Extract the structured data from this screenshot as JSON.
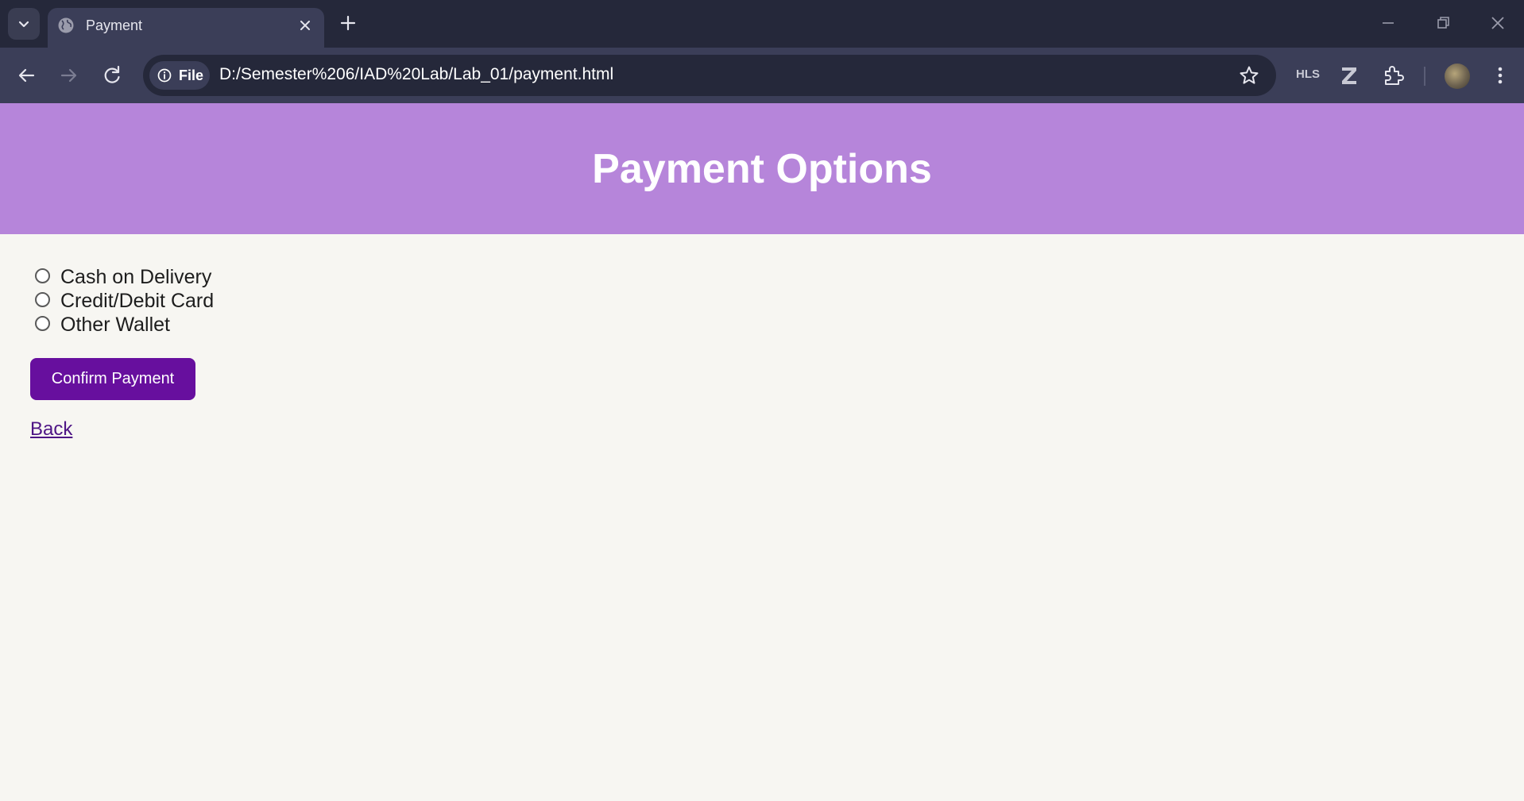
{
  "browser": {
    "tab": {
      "title": "Payment"
    },
    "address_bar": {
      "site_chip_label": "File",
      "url": "D:/Semester%206/IAD%20Lab/Lab_01/payment.html"
    },
    "extensions": {
      "hls_label": "HLS"
    }
  },
  "page": {
    "title": "Payment Options",
    "payment_options": [
      {
        "label": "Cash on Delivery",
        "selected": false
      },
      {
        "label": "Credit/Debit Card",
        "selected": false
      },
      {
        "label": "Other Wallet",
        "selected": false
      }
    ],
    "confirm_button_label": "Confirm Payment",
    "back_link_label": "Back"
  },
  "colors": {
    "header_background": "#b685da",
    "button_background": "#670f9e",
    "link_color": "#4e1585",
    "page_background": "#f7f6f2"
  },
  "icons": [
    "chevron-down-icon",
    "globe-icon",
    "close-icon",
    "plus-icon",
    "minimize-icon",
    "restore-icon",
    "back-arrow-icon",
    "forward-arrow-icon",
    "reload-icon",
    "info-icon",
    "star-icon",
    "zotero-icon",
    "puzzle-icon",
    "kebab-menu-icon"
  ]
}
